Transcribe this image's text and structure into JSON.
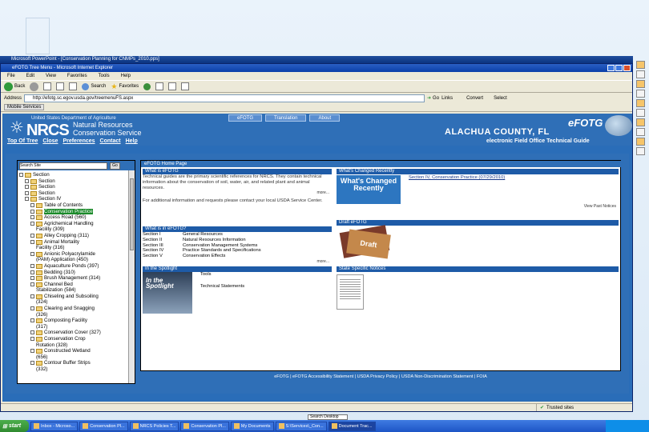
{
  "ppt_title": "Microsoft PowerPoint - [Conservation Planning for CNMPs_2010.pps]",
  "ie": {
    "title": "eFOTG Tree Menu - Microsoft Internet Explorer",
    "menu": [
      "File",
      "Edit",
      "View",
      "Favorites",
      "Tools",
      "Help"
    ],
    "toolbar": {
      "back": "Back",
      "search": "Search",
      "favorites": "Favorites"
    },
    "address_label": "Address",
    "address_value": "http://efotg.sc.egov.usda.gov/treemenuFS.aspx",
    "go_label": "Go",
    "links_label": "Links",
    "convert_label": "Convert",
    "select_label": "Select",
    "links_chip": "Mobile Services"
  },
  "header": {
    "usda": "United States Department of Agriculture",
    "nrcs": "NRCS",
    "nrcs_sub1": "Natural Resources",
    "nrcs_sub2": "Conservation Service",
    "county": "ALACHUA COUNTY, FL",
    "efotg": "eFOTG",
    "efotg_sub": "electronic Field Office Technical Guide",
    "tabs": [
      "eFOTG",
      "Translation",
      "About"
    ],
    "nav": [
      "Top Of Tree",
      "Close",
      "Preferences",
      "Contact",
      "Help"
    ]
  },
  "tree": {
    "search_placeholder": "Search Site",
    "go": "Go",
    "items": [
      {
        "label": "Section",
        "indent": 0,
        "folder": true
      },
      {
        "label": "Section",
        "indent": 1,
        "folder": true
      },
      {
        "label": "Section",
        "indent": 1,
        "folder": true
      },
      {
        "label": "Section",
        "indent": 1,
        "folder": true
      },
      {
        "label": "Section IV",
        "indent": 1,
        "folder": true
      },
      {
        "label": "Table of Contents",
        "indent": 2,
        "folder": true
      },
      {
        "label": "Conservation Practice",
        "indent": 2,
        "folder": true,
        "selected": true
      },
      {
        "label": "Access Road (560)",
        "indent": 2,
        "folder": true
      },
      {
        "label": "Agrichemical Handling",
        "indent": 2,
        "folder": true
      },
      {
        "label": "Facility (309)",
        "indent": 3,
        "folder": false
      },
      {
        "label": "Alley Cropping (311)",
        "indent": 2,
        "folder": true
      },
      {
        "label": "Animal Mortality",
        "indent": 2,
        "folder": true
      },
      {
        "label": "Facility (316)",
        "indent": 3,
        "folder": false
      },
      {
        "label": "Anionic Polyacrylamide",
        "indent": 2,
        "folder": true
      },
      {
        "label": "(PAM) Application (450)",
        "indent": 3,
        "folder": false
      },
      {
        "label": "Aquaculture Ponds (397)",
        "indent": 2,
        "folder": true
      },
      {
        "label": "Bedding (310)",
        "indent": 2,
        "folder": true
      },
      {
        "label": "Brush Management (314)",
        "indent": 2,
        "folder": true
      },
      {
        "label": "Channel Bed",
        "indent": 2,
        "folder": true
      },
      {
        "label": "Stabilization (584)",
        "indent": 3,
        "folder": false
      },
      {
        "label": "Chiseling and Subsoiling",
        "indent": 2,
        "folder": true
      },
      {
        "label": "(324)",
        "indent": 3,
        "folder": false
      },
      {
        "label": "Clearing and Snagging",
        "indent": 2,
        "folder": true
      },
      {
        "label": "(326)",
        "indent": 3,
        "folder": false
      },
      {
        "label": "Composting Facility",
        "indent": 2,
        "folder": true
      },
      {
        "label": "(317)",
        "indent": 3,
        "folder": false
      },
      {
        "label": "Conservation Cover (327)",
        "indent": 2,
        "folder": true
      },
      {
        "label": "Conservation Crop",
        "indent": 2,
        "folder": true
      },
      {
        "label": "Rotation (328)",
        "indent": 3,
        "folder": false
      },
      {
        "label": "Constructed Wetland",
        "indent": 2,
        "folder": true
      },
      {
        "label": "(656)",
        "indent": 3,
        "folder": false
      },
      {
        "label": "Contour Buffer Strips",
        "indent": 2,
        "folder": true
      },
      {
        "label": "(332)",
        "indent": 3,
        "folder": false
      }
    ]
  },
  "main": {
    "tab": "eFOTG Home Page",
    "what_is_efotg": {
      "title": "What is eFOTG",
      "text": "Technical guides are the primary scientific references for NRCS. They contain technical information about the conservation of soil, water, air, and related plant and animal resources.",
      "contact": "For additional information and requests please contact your local USDA Service Center.",
      "more": "more..."
    },
    "whats_changed": {
      "title": "What's Changed Recently",
      "img_text": "What's Changed Recently",
      "item": "Section IV, Conservation Practice (07/29/2010)",
      "more": "View Past Notices"
    },
    "what_is_in": {
      "title": "What is in eFOTG?",
      "rows": [
        {
          "section": "Section I",
          "desc": "General Resources"
        },
        {
          "section": "Section II",
          "desc": "Natural Resources Information"
        },
        {
          "section": "Section III",
          "desc": "Conservation Management Systems"
        },
        {
          "section": "Section IV",
          "desc": "Practice Standards and Specifications"
        },
        {
          "section": "Section V",
          "desc": "Conservation Effects"
        }
      ],
      "more": "more..."
    },
    "draft_efotg": {
      "title": "Draft eFOTG",
      "img_text": "Draft"
    },
    "spotlight": {
      "title": "In the Spotlight",
      "img_text": "In the Spotlight",
      "items": [
        "Tools",
        "Technical Statements"
      ]
    },
    "state_notices": {
      "title": "State Specific Notices"
    }
  },
  "footer": "eFOTG | eFOTG Accessibility Statement | USDA Privacy Policy | USDA Non-Discrimination Statement | FOIA",
  "status": {
    "left": "",
    "zone": "Trusted sites"
  },
  "taskbar": {
    "start": "start",
    "search_value": "Search Desktop",
    "tasks": [
      "Inbox - Microso...",
      "Conservation Pl...",
      "NRCS Policies T...",
      "Conservation Pl...",
      "My Documents",
      "S:\\Services\\_Con...",
      "Document Trac..."
    ]
  }
}
